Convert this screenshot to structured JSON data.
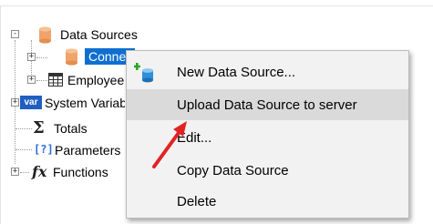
{
  "tree": {
    "items": [
      {
        "label": "Data Sources",
        "icon": "database-icon",
        "expander": "-"
      },
      {
        "label": "Connection",
        "icon": "database-icon",
        "expander": "+"
      },
      {
        "label": "Employees",
        "icon": "table-icon",
        "expander": "+"
      },
      {
        "label": "System Variables",
        "icon": "var-icon",
        "expander": "+"
      },
      {
        "label": "Totals",
        "icon": "sigma-icon",
        "expander": ""
      },
      {
        "label": "Parameters",
        "icon": "parameter-icon",
        "expander": ""
      },
      {
        "label": "Functions",
        "icon": "function-icon",
        "expander": "+"
      }
    ],
    "var_icon_text": "var",
    "param_icon_text": "[?]",
    "fx_icon_text": "fx",
    "sigma_icon_text": "Σ"
  },
  "context_menu": {
    "items": [
      {
        "label": "New Data Source...",
        "icon": "new-data-source-icon"
      },
      {
        "label": "Upload Data Source to server",
        "icon": ""
      },
      {
        "label": "Edit...",
        "icon": ""
      },
      {
        "label": "Copy Data Source",
        "icon": ""
      },
      {
        "label": "Delete",
        "icon": ""
      }
    ],
    "hovered_index": 1
  },
  "colors": {
    "selection": "#0e6fd0",
    "database_orange": "#f0a36a",
    "var_blue": "#1f5fbf",
    "param_blue": "#2a6bd6",
    "arrow_red": "#e02424",
    "menu_bg": "#f2f2f2",
    "menu_hover": "#dadada"
  }
}
